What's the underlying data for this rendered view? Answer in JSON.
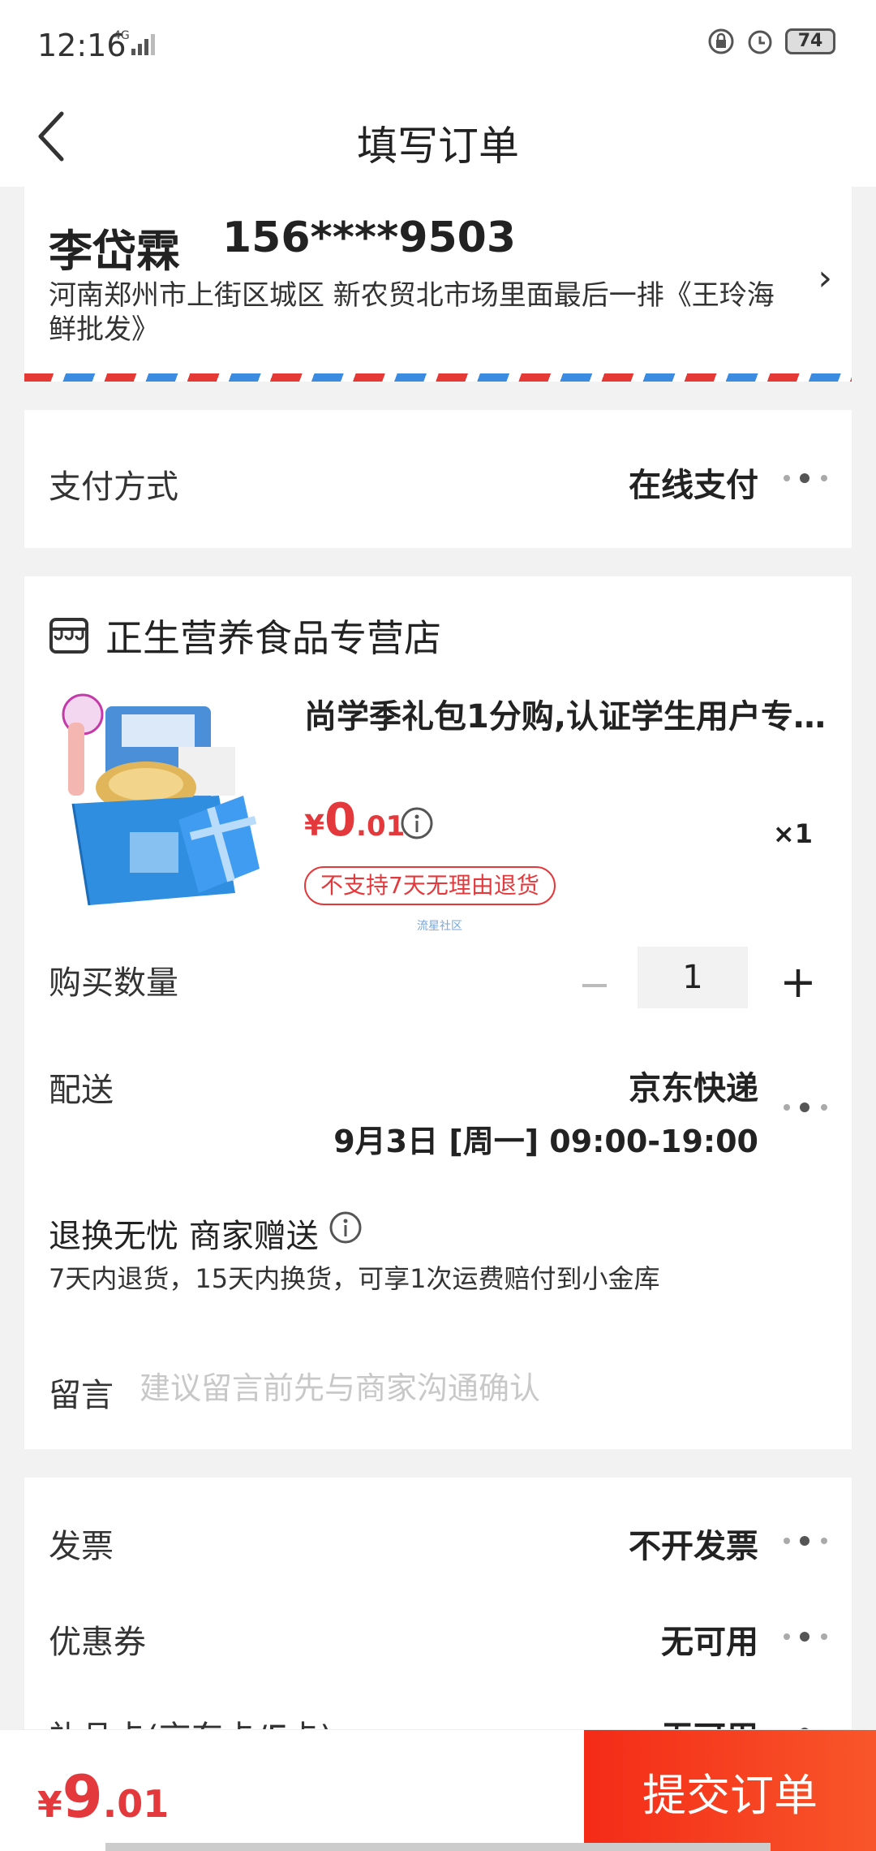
{
  "status_bar": {
    "time": "12:16",
    "network": "4G",
    "battery": "74",
    "icons": [
      "lock-rotation-icon",
      "alarm-icon",
      "battery-icon",
      "signal-icon"
    ]
  },
  "header": {
    "title": "填写订单",
    "back_icon": "chevron-left-icon"
  },
  "address": {
    "name": "李岱霖",
    "phone": "156****9503",
    "detail": "河南郑州市上街区城区 新农贸北市场里面最后一排《王玲海鲜批发》",
    "chevron": "›"
  },
  "payment": {
    "label": "支付方式",
    "value": "在线支付"
  },
  "shop": {
    "name": "正生营养食品专营店",
    "icon": "store-icon"
  },
  "product": {
    "title": "尚学季礼包1分购,认证学生用户专…",
    "price_currency": "¥",
    "price_int": "0",
    "price_dec": ".01",
    "quantity_mark": "×1",
    "return_badge": "不支持7天无理由退货",
    "watermark": "流星社区"
  },
  "quantity": {
    "label": "购买数量",
    "minus": "−",
    "value": "1",
    "plus": "+"
  },
  "shipping": {
    "label": "配送",
    "carrier": "京东快递",
    "time": "9月3日 [周一] 09:00-19:00"
  },
  "returns": {
    "title": "退换无忧 商家赠送",
    "desc": "7天内退货，15天内换货，可享1次运费赔付到小金库"
  },
  "message": {
    "label": "留言",
    "placeholder": "建议留言前先与商家沟通确认"
  },
  "invoice": {
    "label": "发票",
    "value": "不开发票"
  },
  "coupon": {
    "label": "优惠券",
    "value": "无可用"
  },
  "gift_card": {
    "label": "礼品卡(京东卡/E卡)",
    "value": "无可用"
  },
  "footer": {
    "total_currency": "¥",
    "total_int": "9",
    "total_dec": ".01",
    "submit": "提交订单"
  },
  "colors": {
    "accent": "#e4393c",
    "submit_start": "#f42b17",
    "submit_end": "#f8562a",
    "airmail_red": "#e53935",
    "airmail_blue": "#3b8be0"
  }
}
